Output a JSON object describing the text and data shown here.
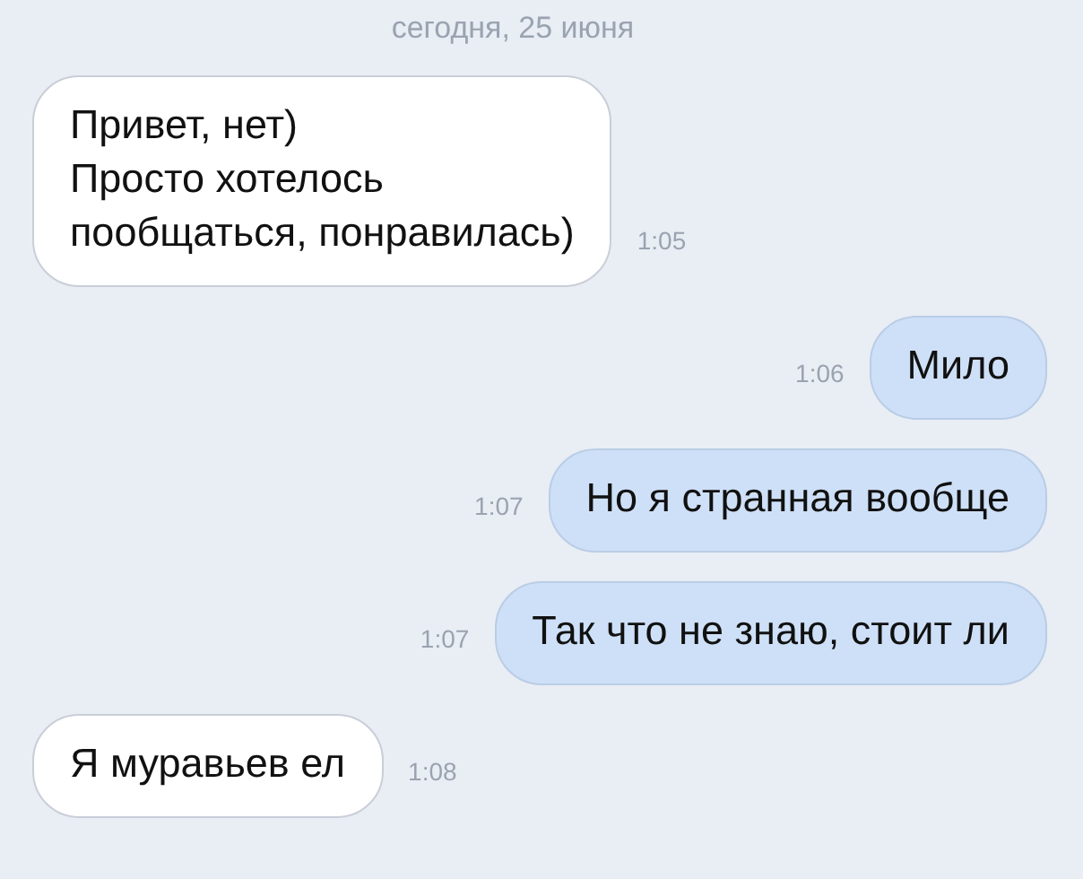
{
  "date": "сегодня, 25 июня",
  "messages": [
    {
      "kind": "incoming",
      "text": "Привет, нет)\nПросто хотелось\nпообщаться, понравилась)",
      "time": "1:05"
    },
    {
      "kind": "outgoing",
      "text": "Мило",
      "time": "1:06"
    },
    {
      "kind": "outgoing",
      "text": "Но я странная вообще",
      "time": "1:07"
    },
    {
      "kind": "outgoing",
      "text": "Так что не знаю, стоит ли",
      "time": "1:07"
    },
    {
      "kind": "incoming",
      "text": "Я муравьев ел",
      "time": "1:08"
    }
  ]
}
